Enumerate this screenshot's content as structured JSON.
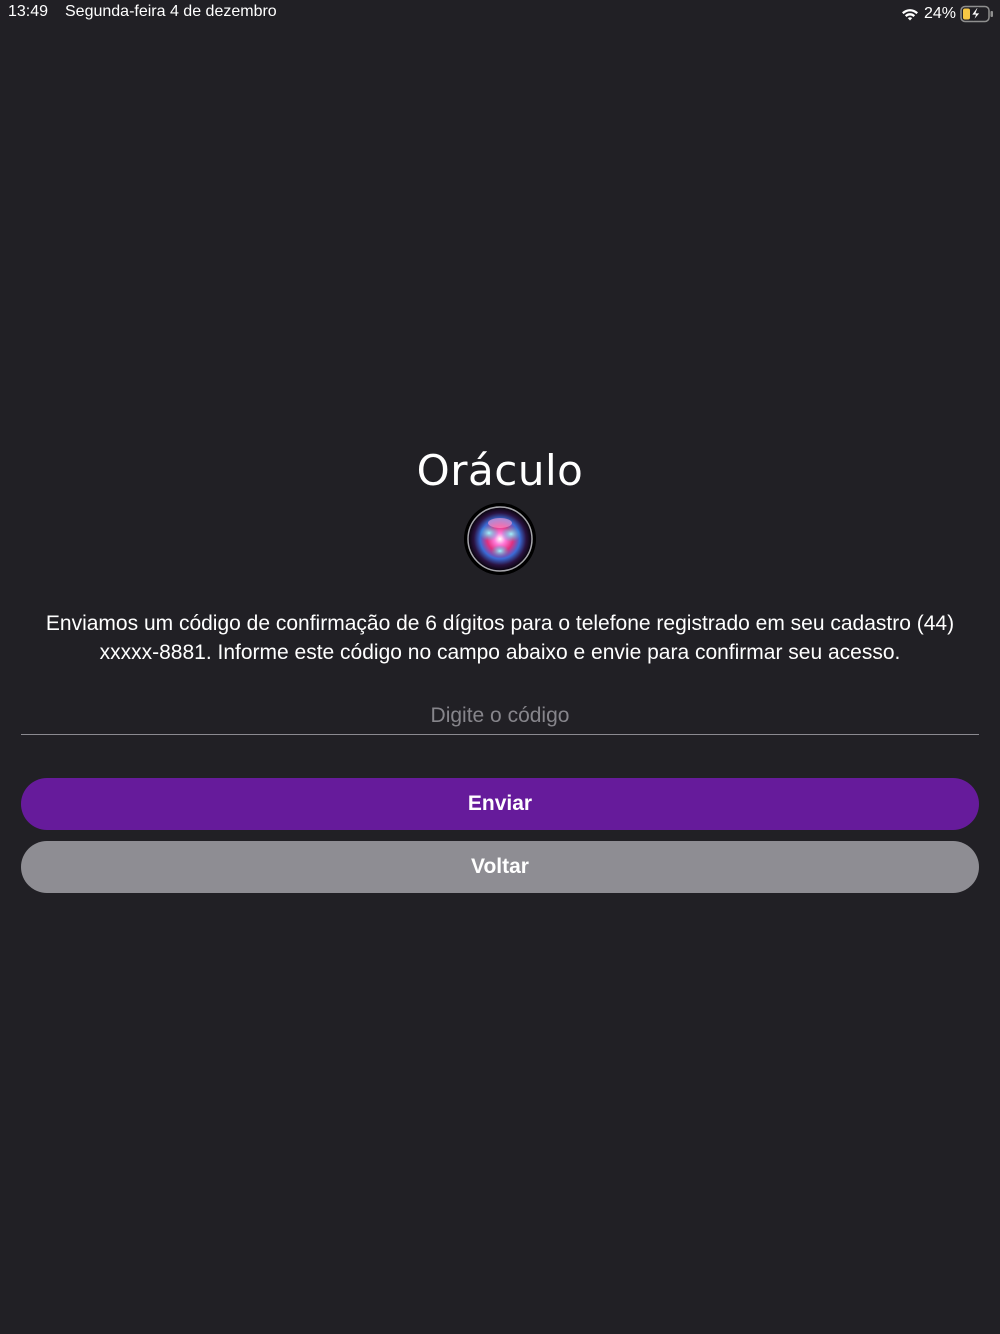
{
  "status_bar": {
    "time": "13:49",
    "date": "Segunda-feira 4 de dezembro",
    "battery_percent": "24%",
    "wifi_icon": "wifi-icon",
    "battery_icon": "battery-charging-icon",
    "battery_color": "#f6c744"
  },
  "app": {
    "title": "Oráculo",
    "logo_icon": "crystal-orb-logo"
  },
  "message": "Enviamos um código de confirmação de 6 dígitos para o telefone registrado em seu cadastro (44) xxxxx-8881. Informe este código no campo abaixo e envie para confirmar seu acesso.",
  "code_input": {
    "placeholder": "Digite o código",
    "value": ""
  },
  "buttons": {
    "send_label": "Enviar",
    "back_label": "Voltar"
  },
  "colors": {
    "background": "#212025",
    "primary": "#661b9b",
    "secondary": "#8e8d93"
  }
}
